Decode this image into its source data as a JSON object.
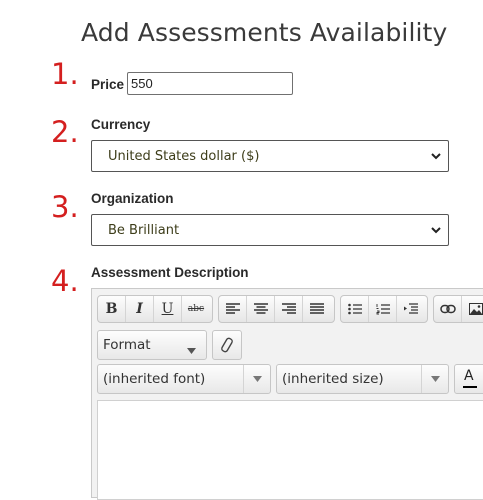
{
  "page": {
    "title": "Add Assessments Availability"
  },
  "steps": [
    "1.",
    "2.",
    "3.",
    "4."
  ],
  "price": {
    "label": "Price",
    "value": "550"
  },
  "currency": {
    "label": "Currency",
    "selected": "United States dollar ($)"
  },
  "organization": {
    "label": "Organization",
    "selected": "Be Brilliant"
  },
  "description": {
    "label": "Assessment Description",
    "toolbar": {
      "bold": "B",
      "italic": "I",
      "underline": "U",
      "strike": "abc",
      "format": "Format",
      "font": "(inherited font)",
      "size": "(inherited size)",
      "text_color": "A"
    }
  },
  "colors": {
    "step_number": "#d41f1f",
    "text_color_underline": "#000000"
  }
}
